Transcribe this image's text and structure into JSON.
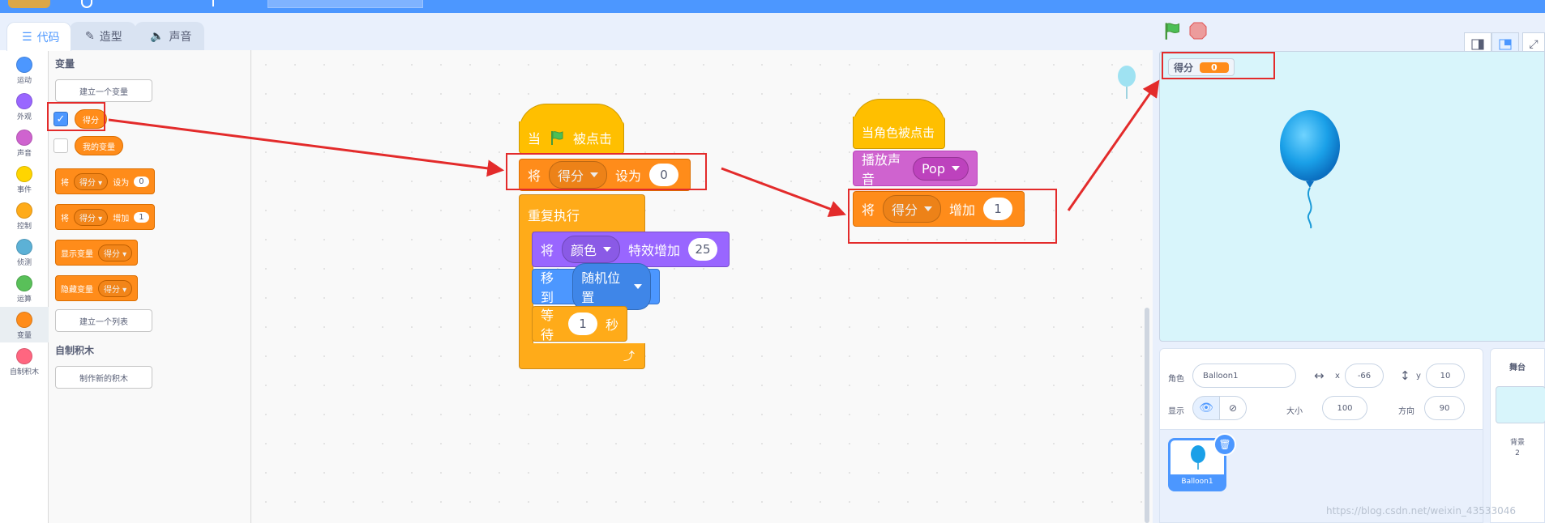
{
  "tabs": [
    {
      "label": "代码",
      "icon": "code-icon",
      "active": true
    },
    {
      "label": "造型",
      "icon": "brush-icon",
      "active": false
    },
    {
      "label": "声音",
      "icon": "speaker-icon",
      "active": false
    }
  ],
  "categories": [
    {
      "label": "运动",
      "color": "#4c97ff"
    },
    {
      "label": "外观",
      "color": "#9966ff"
    },
    {
      "label": "声音",
      "color": "#cf63cf"
    },
    {
      "label": "事件",
      "color": "#ffd500"
    },
    {
      "label": "控制",
      "color": "#ffab19"
    },
    {
      "label": "侦测",
      "color": "#5cb1d6"
    },
    {
      "label": "运算",
      "color": "#59c059"
    },
    {
      "label": "变量",
      "color": "#ff8c1a",
      "selected": true
    },
    {
      "label": "自制积木",
      "color": "#ff6680"
    }
  ],
  "palette": {
    "variables_title": "变量",
    "make_variable": "建立一个变量",
    "var_score": "得分",
    "var_mine": "我的变量",
    "set_word": "将",
    "set_dd": "得分",
    "set_to": "设为",
    "set_val": "0",
    "change_word": "将",
    "change_dd": "得分",
    "change_by": "增加",
    "change_val": "1",
    "show_var": "显示变量",
    "show_dd": "得分",
    "hide_var": "隐藏变量",
    "hide_dd": "得分",
    "make_list": "建立一个列表",
    "myblocks_title": "自制积木",
    "make_block": "制作新的积木"
  },
  "script1": {
    "hat_when": "当",
    "hat_clicked": "被点击",
    "set_word": "将",
    "set_dd": "得分",
    "set_to": "设为",
    "set_val": "0",
    "forever": "重复执行",
    "effect_word": "将",
    "effect_dd": "颜色",
    "effect_text": "特效增加",
    "effect_val": "25",
    "goto_word": "移到",
    "goto_dd": "随机位置",
    "wait_word": "等待",
    "wait_val": "1",
    "wait_unit": "秒"
  },
  "script2": {
    "hat": "当角色被点击",
    "sound_word": "播放声音",
    "sound_dd": "Pop",
    "change_word": "将",
    "change_dd": "得分",
    "change_by": "增加",
    "change_val": "1"
  },
  "stage": {
    "monitor_label": "得分",
    "monitor_value": "0"
  },
  "sprite_info": {
    "sprite_label": "角色",
    "sprite_name": "Balloon1",
    "x_label": "x",
    "x_value": "-66",
    "y_label": "y",
    "y_value": "10",
    "show_label": "显示",
    "size_label": "大小",
    "size_value": "100",
    "direction_label": "方向",
    "direction_value": "90"
  },
  "sprites": [
    {
      "name": "Balloon1"
    }
  ],
  "stage_pane": {
    "title": "舞台",
    "backdrops_label": "背景",
    "backdrops_count": "2"
  },
  "watermark": "https://blog.csdn.net/weixin_43533046",
  "colors": {
    "motion": "#4c97ff",
    "looks": "#9966ff",
    "sound": "#cf63cf",
    "events": "#ffbf00",
    "control": "#ffab19",
    "variables": "#ff8c1a",
    "highlight": "#e32b2b"
  }
}
